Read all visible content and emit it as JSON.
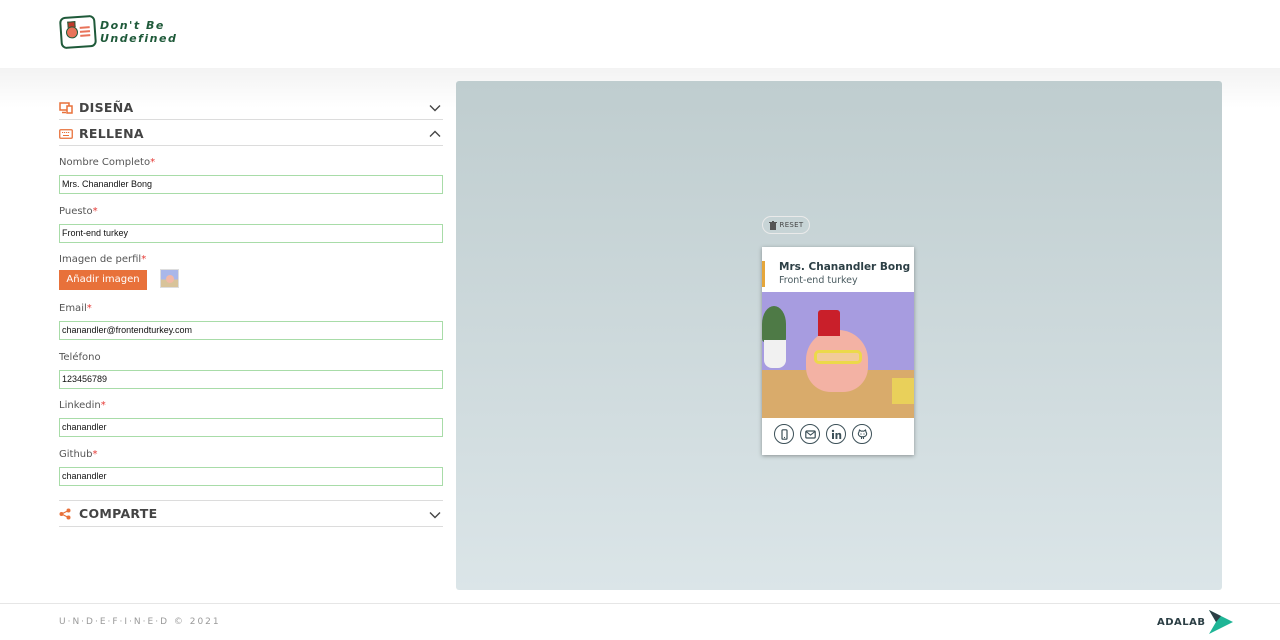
{
  "header": {
    "logo_line1": "Don't Be",
    "logo_line2": "Undefined"
  },
  "sections": {
    "design": {
      "title": "DISEÑA"
    },
    "fill": {
      "title": "RELLENA"
    },
    "share": {
      "title": "COMPARTE"
    }
  },
  "form": {
    "name": {
      "label": "Nombre Completo",
      "required_mark": "*",
      "value": "Mrs. Chanandler Bong"
    },
    "job": {
      "label": "Puesto",
      "required_mark": "*",
      "value": "Front-end turkey"
    },
    "image": {
      "label": "Imagen de perfil",
      "required_mark": "*",
      "button_label": "Añadir imagen"
    },
    "email": {
      "label": "Email",
      "required_mark": "*",
      "value": "chanandler@frontendturkey.com"
    },
    "phone": {
      "label": "Teléfono",
      "value": "123456789"
    },
    "linkedin": {
      "label": "Linkedin",
      "required_mark": "*",
      "value": "chanandler"
    },
    "github": {
      "label": "Github",
      "required_mark": "*",
      "value": "chanandler"
    }
  },
  "preview": {
    "reset_label": "RESET",
    "card": {
      "name": "Mrs. Chanandler Bong",
      "job": "Front-end turkey",
      "social_icons": [
        "phone-icon",
        "email-icon",
        "linkedin-icon",
        "github-icon"
      ]
    }
  },
  "footer": {
    "copyright": "U·N·D·E·F·I·N·E·D © 2021",
    "brand": "ADALAB"
  },
  "colors": {
    "accent": "#e8713a",
    "card_accent": "#e5a63b",
    "input_border": "#a8dca8",
    "required": "#e53935",
    "logo_green": "#1f5a3a"
  }
}
